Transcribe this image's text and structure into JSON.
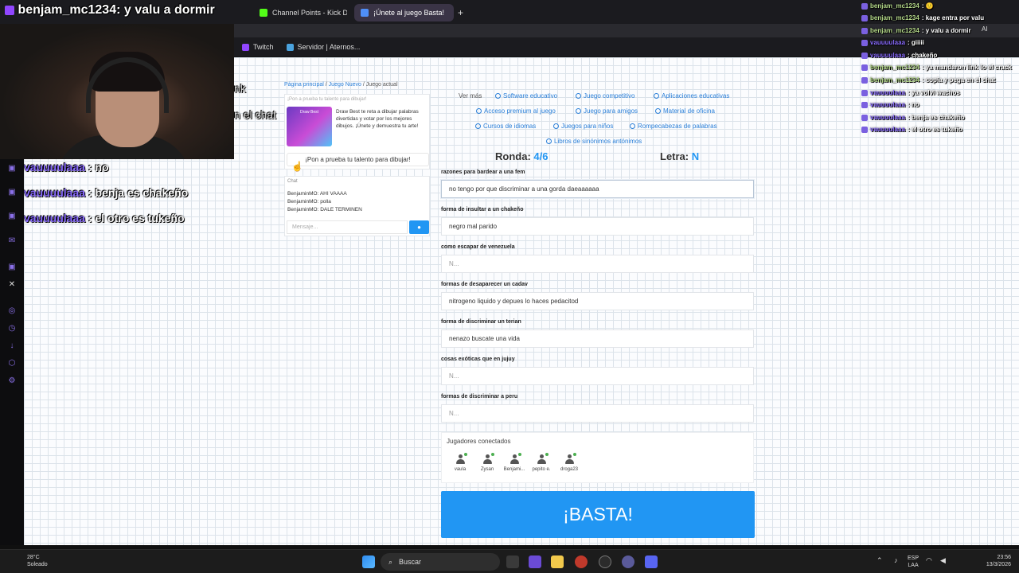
{
  "browser": {
    "tabs": [
      {
        "label": "benjam_mc1234: y valu a dormir"
      },
      {
        "label": "Channel Points - Kick Das"
      },
      {
        "label": "¡Únete al juego Basta!"
      }
    ],
    "new_tab": "+",
    "bookmarks": [
      {
        "label": "Twitch"
      },
      {
        "label": "Servidor | Aternos..."
      }
    ]
  },
  "stream_overlay": {
    "chat": [
      {
        "user": "vauuuulaaa",
        "sep": " : ",
        "msg": "no"
      },
      {
        "user": "vauuuulaaa",
        "sep": " : ",
        "msg": "benja es chakeño"
      },
      {
        "user": "vauuuulaaa",
        "sep": " : ",
        "msg": "el otro es tukeño"
      }
    ],
    "partial_left_1": "nk",
    "partial_left_2": "n el chat"
  },
  "side_chat": [
    {
      "user": "benjam_mc1234",
      "msg": ": 🙂"
    },
    {
      "user": "benjam_mc1234",
      "msg": ": kage entra por valu"
    },
    {
      "user": "benjam_mc1234",
      "msg": ": y valu a dormir"
    },
    {
      "user": "vauuuulaaa",
      "msg": ": giiiii"
    },
    {
      "user": "vauuuulaaa",
      "msg": ": chakeño"
    },
    {
      "user": "benjam_mc1234",
      "msg": ": ya mandaron link"
    },
    {
      "user": "benjam_mc1234",
      "msg": ": copia y pega en el chat"
    },
    {
      "user": "vauuuulaaa",
      "msg": ": ya volvi wachos"
    },
    {
      "user": "vauuuulaaa",
      "msg": ": no"
    },
    {
      "user": "vauuuulaaa",
      "msg": ": benja es chakeño"
    },
    {
      "user": "vauuuulaaa",
      "msg": ": el otro es tukeño"
    }
  ],
  "side_chat_extra": "lo el crack",
  "side_chat_ai": "AI",
  "breadcrumb": {
    "home": "Página principal",
    "sep": "/",
    "new_game": "Juego Nuevo",
    "current": "Juego actual"
  },
  "ad": {
    "caption": "¡Pon a prueba tu talento para dibujar!",
    "img_label": "Draw Best",
    "text": "Draw Best te reta a dibujar palabras divertidas y votar por los mejores dibujos. ¡Únete y demuestra tu arte!",
    "button": "¡Pon a prueba tu talento para dibujar!"
  },
  "chat": {
    "title": "Chat",
    "messages": [
      {
        "user": "BenjaminMO:",
        "text": "AHI VAAAA"
      },
      {
        "user": "BenjaminMO:",
        "text": "polla"
      },
      {
        "user": "BenjaminMO:",
        "text": "DALE TERMINEN"
      }
    ],
    "placeholder": "Mensaje..."
  },
  "links": {
    "see_more": "Ver más",
    "items": [
      "Software educativo",
      "Juego competitivo",
      "Aplicaciones educativas",
      "Acceso premium al juego",
      "Juego para amigos",
      "Material de oficina",
      "Cursos de idiomas",
      "Juegos para niños",
      "Rompecabezas de palabras",
      "Libros de sinónimos antónimos"
    ]
  },
  "game": {
    "round_label": "Ronda:",
    "round_value": "4/6",
    "letter_label": "Letra:",
    "letter_value": "N",
    "fields": [
      {
        "label": "razones para bardear a una fem",
        "value": "no tengo por que discriminar a una gorda daeaaaaaa"
      },
      {
        "label": "forma de insultar a un chakeño",
        "value": "negro mal parido"
      },
      {
        "label": "como escapar de venezuela",
        "value": "",
        "placeholder": "N..."
      },
      {
        "label": "formas de desaparecer un cadav",
        "value": "nitrogeno liquido y depues lo haces pedacitod"
      },
      {
        "label": "forma de discriminar un terian",
        "value": "nenazo buscate una vida"
      },
      {
        "label": "cosas exóticas que en jujuy",
        "value": "",
        "placeholder": "N..."
      },
      {
        "label": "formas de discriminar a peru",
        "value": "",
        "placeholder": "N..."
      }
    ],
    "players_title": "Jugadores conectados",
    "players": [
      "vaula",
      "Zysan",
      "Benjami...",
      "pepito e.",
      "droga23"
    ],
    "basta": "¡BASTA!"
  },
  "taskbar": {
    "weather_temp": "28°C",
    "weather_desc": "Soleado",
    "search": "Buscar",
    "lang1": "ESP",
    "lang2": "LAA",
    "time": "23:56",
    "date": "13/3/2026"
  },
  "colors": {
    "accent": "#2196f3",
    "link": "#2a7fd8",
    "twitch": "#8a6cff",
    "taskbar": "#1c1c1c"
  }
}
